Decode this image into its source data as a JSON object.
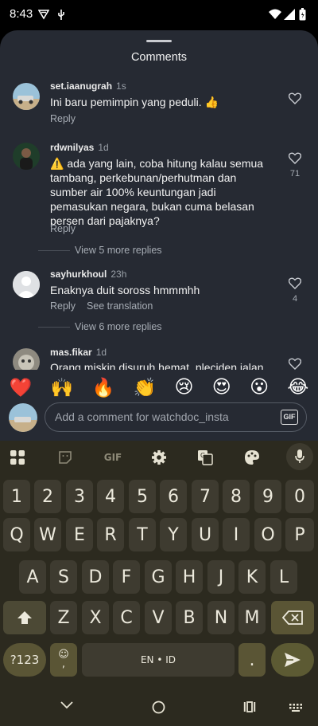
{
  "status": {
    "time": "8:43"
  },
  "sheet": {
    "title": "Comments"
  },
  "comments": [
    {
      "user": "set.iaanugrah",
      "time": "1s",
      "text": "Ini baru pemimpin yang peduli. 👍",
      "reply": "Reply",
      "likes": ""
    },
    {
      "user": "rdwnilyas",
      "time": "1d",
      "text": "⚠️ ada yang lain, coba hitung kalau semua tambang, perkebunan/perhutman dan sumber air 100% keuntungan jadi pemasukan negara, bukan cuma belasan persen dari pajaknya?",
      "reply": "Reply",
      "likes": "71",
      "view_more": "View 5 more replies"
    },
    {
      "user": "sayhurkhoul",
      "time": "23h",
      "text": "Enaknya duit soross hmmmhh",
      "reply": "Reply",
      "translation": "See translation",
      "likes": "4",
      "view_more": "View 6 more replies"
    },
    {
      "user": "mas.fikar",
      "time": "1d",
      "text": "Orang miskin disuruh hemat, pleciden jalan",
      "likes": ""
    }
  ],
  "emoji_bar": [
    "❤️",
    "🙌",
    "🔥",
    "👏",
    "😢",
    "😍",
    "😮",
    "😂"
  ],
  "comment_input": {
    "placeholder": "Add a comment for watchdoc_insta",
    "gif": "GIF"
  },
  "keyboard": {
    "toolbar_gif": "GIF",
    "row_numbers": [
      "1",
      "2",
      "3",
      "4",
      "5",
      "6",
      "7",
      "8",
      "9",
      "0"
    ],
    "row1": [
      "Q",
      "W",
      "E",
      "R",
      "T",
      "Y",
      "U",
      "I",
      "O",
      "P"
    ],
    "row2": [
      "A",
      "S",
      "D",
      "F",
      "G",
      "H",
      "J",
      "K",
      "L"
    ],
    "row3": [
      "Z",
      "X",
      "C",
      "V",
      "B",
      "N",
      "M"
    ],
    "symbols_key": "?123",
    "emoji_key_top": "☺",
    "emoji_key_bottom": ",",
    "space_label": "EN • ID",
    "period_key": ".",
    "shift_glyph": "⇧"
  },
  "colors": {
    "sheet_bg": "#262a33",
    "keyboard_bg": "#2c2a1f",
    "key_bg": "#3e3b30",
    "accent": "#5c5a33"
  },
  "icons": [
    "wifi-icon",
    "battery-icon",
    "heart-icon",
    "grid-icon",
    "sticker-icon",
    "gear-icon",
    "translate-icon",
    "palette-icon",
    "mic-icon",
    "backspace-icon",
    "send-icon",
    "back-nav-icon",
    "home-nav-icon",
    "recents-nav-icon",
    "keyboard-switch-icon"
  ]
}
